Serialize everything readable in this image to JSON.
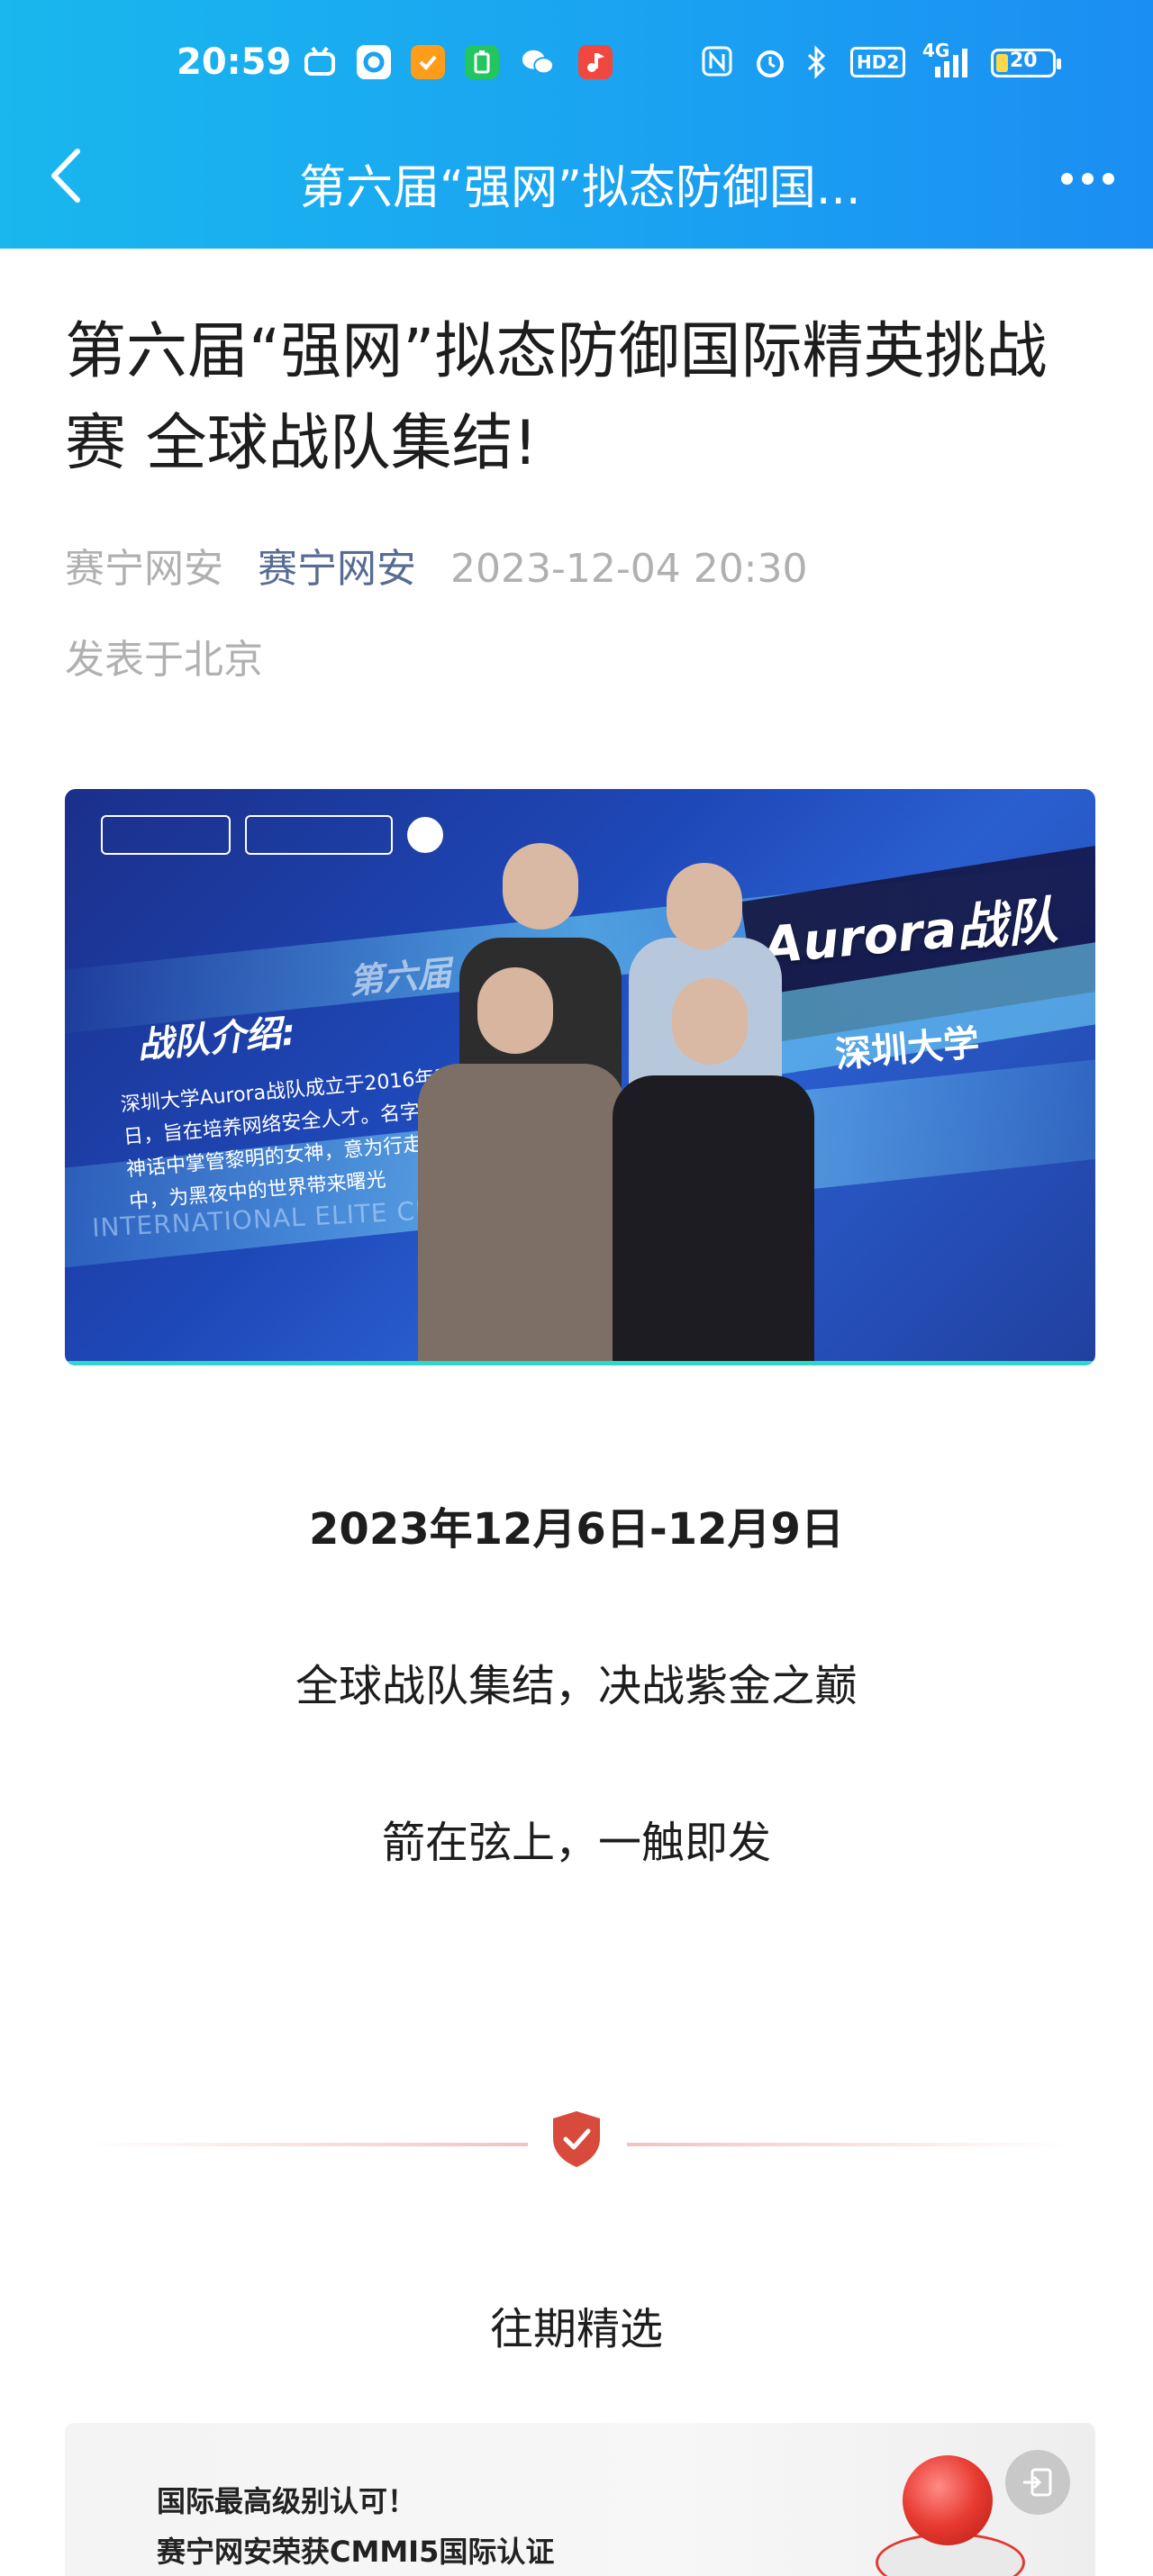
{
  "status": {
    "time": "20:59",
    "battery": "20",
    "network": "4G",
    "hd": "HD2"
  },
  "header": {
    "title": "第六届“强网”拟态防御国..."
  },
  "article": {
    "title": "第六届“强网”拟态防御国际精英挑战赛 全球战队集结!",
    "author": "赛宁网安",
    "account": "赛宁网安",
    "datetime": "2023-12-04 20:30",
    "location": "发表于北京"
  },
  "hero": {
    "team": "Aurora战队",
    "university": "深圳大学",
    "intro_heading": "战队介绍:",
    "intro_text": "深圳大学Aurora战队成立于2016年3月23日，旨在培养网络安全人才。名字来源罗马神话中掌管黎明的女神，意为行走在黑暗中，为黑夜中的世界带来曙光",
    "ghost_text": "第六届",
    "elite_text": "INTERNATIONAL ELITE CHAL"
  },
  "body": {
    "date_line": "2023年12月6日-12月9日",
    "line1": "全球战队集结，决战紫金之巅",
    "line2": "箭在弦上，一触即发"
  },
  "section": {
    "title": "往期精选"
  },
  "card": {
    "line1": "国际最高级别认可！",
    "line2": "赛宁网安荣获CMMI5国际认证"
  },
  "colors": {
    "header_blue": "#1aa3f1",
    "account_link": "#576b95",
    "shield_red": "#d84a3c"
  }
}
